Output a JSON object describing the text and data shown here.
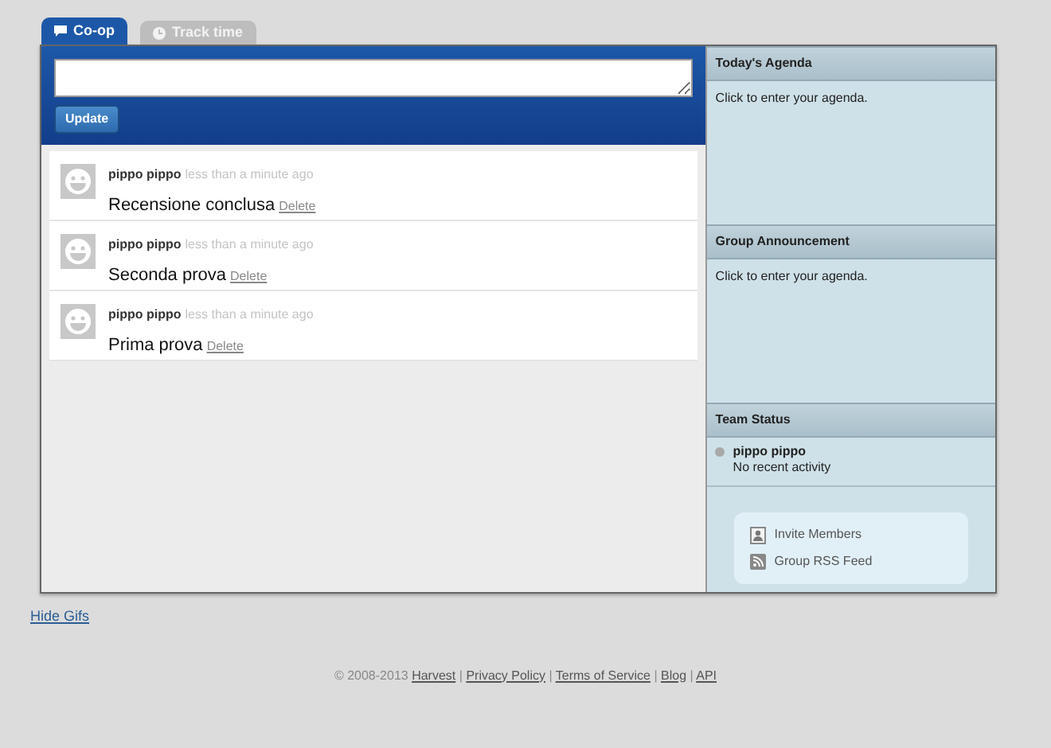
{
  "tabs": [
    {
      "label": "Co-op",
      "kind": "chat",
      "selected": true
    },
    {
      "label": "Track time",
      "kind": "clock",
      "selected": false
    }
  ],
  "composer": {
    "button": "Update"
  },
  "posts": [
    {
      "author": "pippo pippo",
      "time": "less than a minute ago",
      "text": "Recensione conclusa",
      "action": "Delete"
    },
    {
      "author": "pippo pippo",
      "time": "less than a minute ago",
      "text": "Seconda prova",
      "action": "Delete"
    },
    {
      "author": "pippo pippo",
      "time": "less than a minute ago",
      "text": "Prima prova",
      "action": "Delete"
    }
  ],
  "sidebar": {
    "agenda": {
      "title": "Today's Agenda",
      "text": "Click to enter your agenda."
    },
    "announcement": {
      "title": "Group Announcement",
      "text": "Click to enter your agenda."
    },
    "team": {
      "title": "Team Status",
      "members": [
        {
          "name": "pippo pippo",
          "status": "No recent activity",
          "active": false
        }
      ]
    },
    "links": [
      {
        "kind": "invite",
        "label": "Invite Members"
      },
      {
        "kind": "rss",
        "label": "Group RSS Feed"
      }
    ]
  },
  "hide_link": "Hide Gifs",
  "footer": [
    {
      "kind": "text",
      "text": "© 2008-2013"
    },
    {
      "kind": "link",
      "text": "Harvest"
    },
    {
      "kind": "sep",
      "text": "|"
    },
    {
      "kind": "link",
      "text": "Privacy Policy"
    },
    {
      "kind": "sep",
      "text": "|"
    },
    {
      "kind": "link",
      "text": "Terms of Service"
    },
    {
      "kind": "sep",
      "text": "|"
    },
    {
      "kind": "link",
      "text": "Blog"
    },
    {
      "kind": "sep",
      "text": "|"
    },
    {
      "kind": "link",
      "text": "API"
    }
  ]
}
